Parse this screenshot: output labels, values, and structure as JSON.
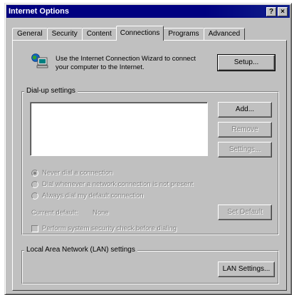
{
  "window": {
    "title": "Internet Options",
    "help_button": "?",
    "close_button": "×"
  },
  "tabs": [
    {
      "label": "General",
      "active": false
    },
    {
      "label": "Security",
      "active": false
    },
    {
      "label": "Content",
      "active": false
    },
    {
      "label": "Connections",
      "active": true
    },
    {
      "label": "Programs",
      "active": false
    },
    {
      "label": "Advanced",
      "active": false
    }
  ],
  "wizard": {
    "text": "Use the Internet Connection Wizard to connect your computer to the Internet.",
    "setup_button": "Setup..."
  },
  "dialup": {
    "group_label": "Dial-up settings",
    "add_button": "Add...",
    "remove_button": "Remove",
    "settings_button": "Settings...",
    "radio_never": "Never dial a connection",
    "radio_when_not_present": "Dial whenever a network connection is not present",
    "radio_always": "Always dial my default connection",
    "current_default_label": "Current default:",
    "current_default_value": "None",
    "set_default_button": "Set Default",
    "checkbox_security": "Perform system security check before dialing"
  },
  "lan": {
    "group_label": "Local Area Network (LAN) settings",
    "lan_settings_button": "LAN Settings..."
  }
}
